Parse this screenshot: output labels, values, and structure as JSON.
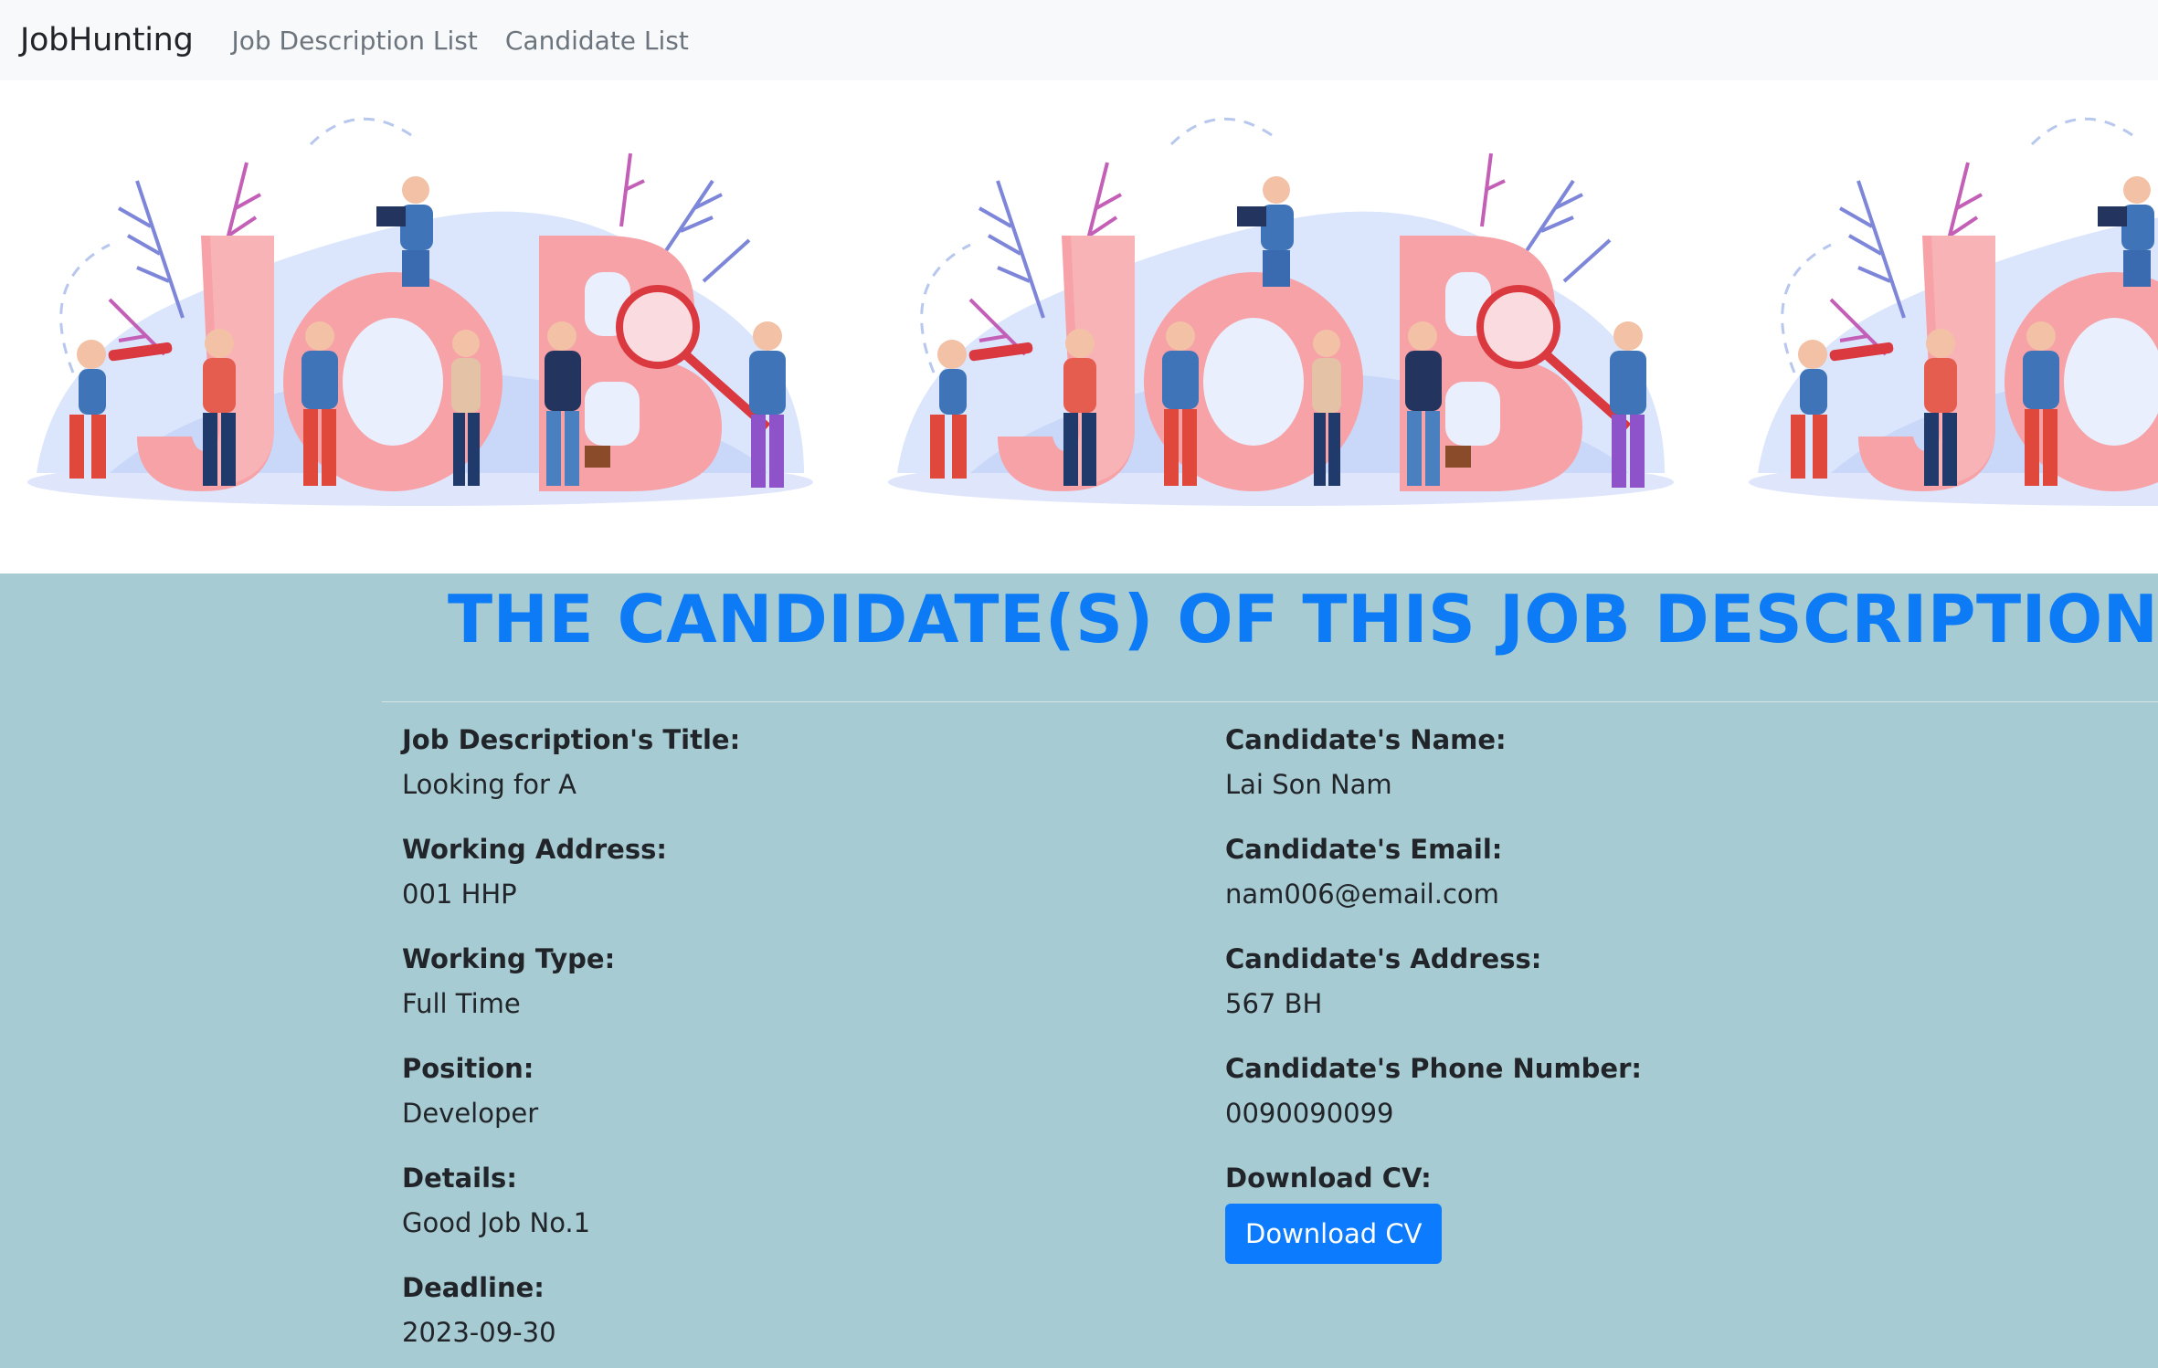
{
  "nav": {
    "brand": "JobHunting",
    "links": [
      "Job Description List",
      "Candidate List"
    ]
  },
  "banner": {
    "art_text": "JOB"
  },
  "heading": "THE CANDIDATE(S) OF THIS JOB DESCRIPTION",
  "job": [
    {
      "label": "Job Description's Title:",
      "value": "Looking for A"
    },
    {
      "label": "Working Address:",
      "value": "001 HHP"
    },
    {
      "label": "Working Type:",
      "value": "Full Time"
    },
    {
      "label": "Position:",
      "value": "Developer"
    },
    {
      "label": "Details:",
      "value": "Good Job No.1"
    },
    {
      "label": "Deadline:",
      "value": "2023-09-30"
    }
  ],
  "candidate": [
    {
      "label": "Candidate's Name:",
      "value": "Lai Son Nam"
    },
    {
      "label": "Candidate's Email:",
      "value": "nam006@email.com"
    },
    {
      "label": "Candidate's Address:",
      "value": "567 BH"
    },
    {
      "label": "Candidate's Phone Number:",
      "value": "0090090099"
    }
  ],
  "download": {
    "label": "Download CV:",
    "button": "Download CV"
  },
  "colors": {
    "heading": "#0d7bf5",
    "background": "#a6cbd2",
    "button": "#0d7bfd",
    "art_letters": "#f8a8ad"
  }
}
